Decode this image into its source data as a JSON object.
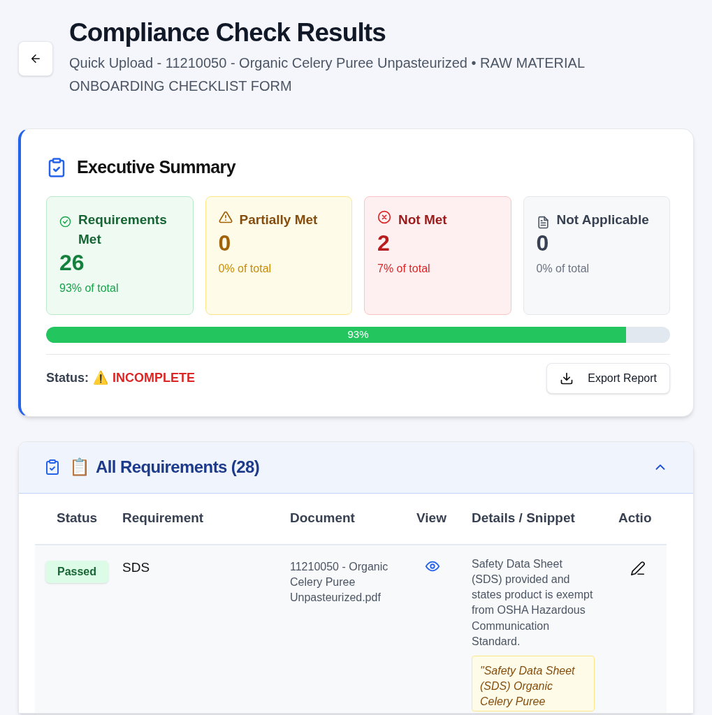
{
  "header": {
    "title": "Compliance Check Results",
    "subtitle": "Quick Upload - 11210050 - Organic Celery Puree Unpasteurized • RAW MATERIAL ONBOARDING CHECKLIST FORM"
  },
  "summary": {
    "title": "Executive Summary",
    "stats": [
      {
        "kind": "met",
        "label": "Requirements Met",
        "value": "26",
        "share": "93% of total"
      },
      {
        "kind": "partial",
        "label": "Partially Met",
        "value": "0",
        "share": "0% of total"
      },
      {
        "kind": "notmet",
        "label": "Not Met",
        "value": "2",
        "share": "7% of total"
      },
      {
        "kind": "na",
        "label": "Not Applicable",
        "value": "0",
        "share": "0% of total"
      }
    ],
    "progress": {
      "level": 0.93,
      "reading": "93%"
    },
    "status_label": "Status:",
    "status_icon": "⚠️",
    "status_value": "INCOMPLETE",
    "export_button": "Export Report"
  },
  "requirements": {
    "emoji": "📋",
    "title": "All Requirements (28)",
    "expanded": true,
    "columns": [
      "Status",
      "Requirement",
      "Document",
      "View",
      "Details / Snippet",
      "Actio"
    ],
    "rows": [
      {
        "status": "Passed",
        "kind": "passed",
        "requirement": "SDS",
        "document": "11210050 - Organic Celery Puree Unpasteurized.pdf",
        "details": "Safety Data Sheet (SDS) provided and states product is exempt from OSHA Hazardous Communication Standard.",
        "snippet": "\"Safety Data Sheet (SDS) Organic Celery Puree"
      }
    ]
  }
}
